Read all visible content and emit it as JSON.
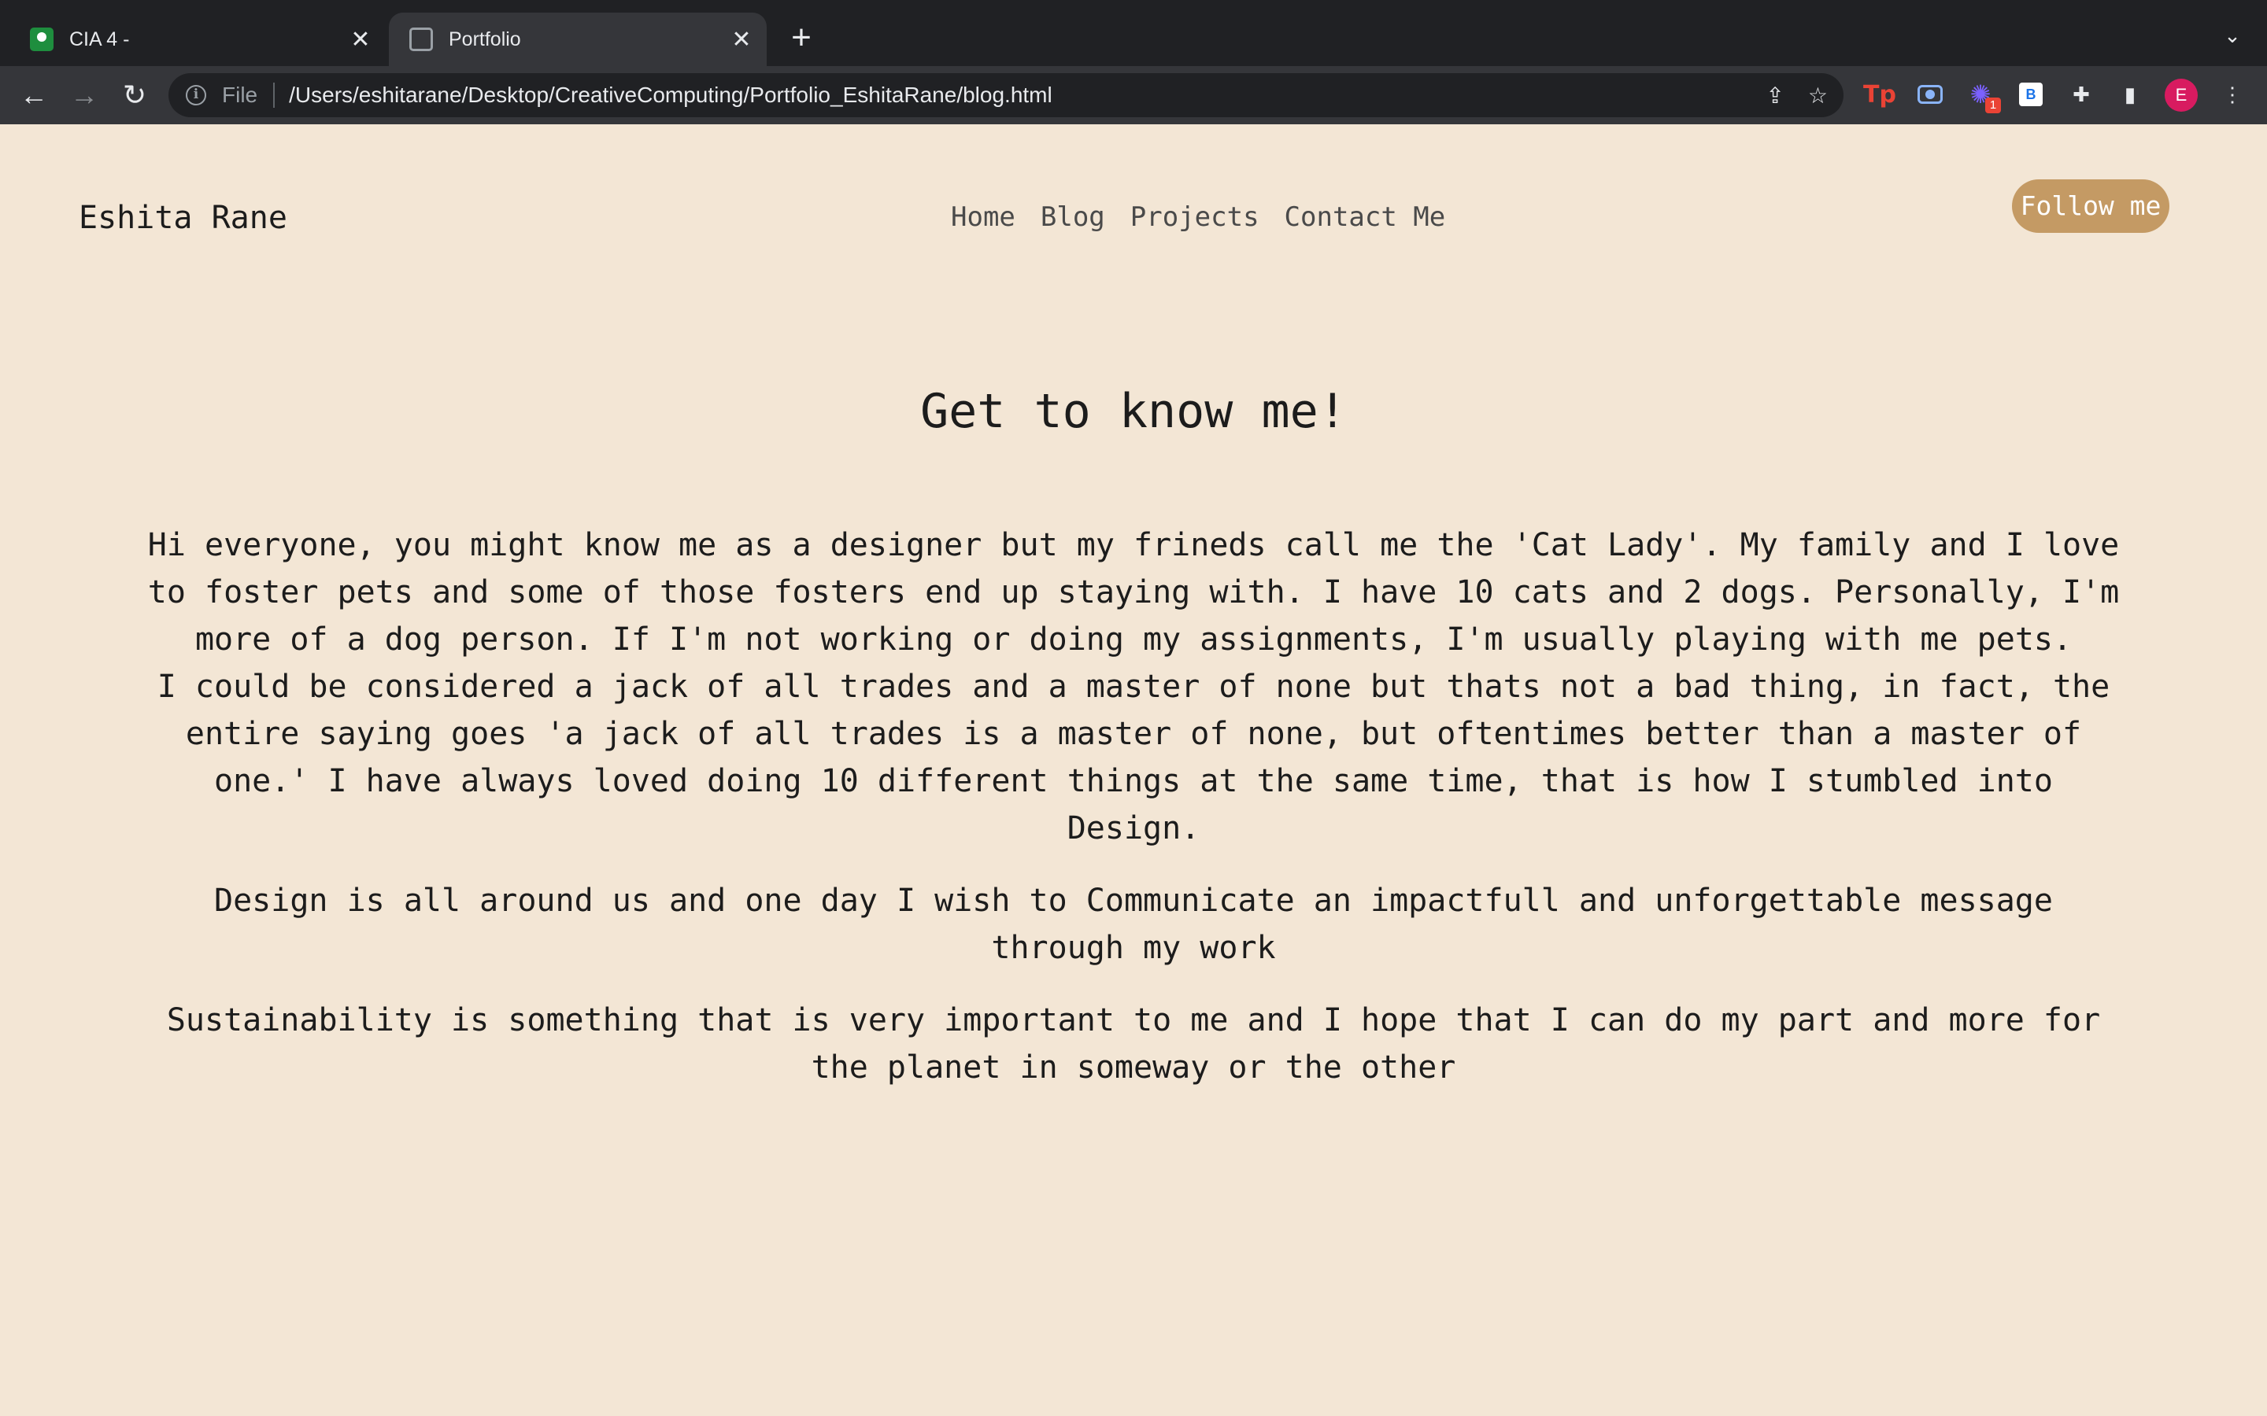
{
  "browser": {
    "tabs": [
      {
        "title": "CIA 4 -",
        "favicon": "classroom-icon",
        "active": false
      },
      {
        "title": "Portfolio",
        "favicon": "globe-icon",
        "active": true
      }
    ],
    "address": {
      "scheme_label": "File",
      "url": "/Users/eshitarane/Desktop/CreativeComputing/Portfolio_EshitaRane/blog.html"
    },
    "profile_initial": "E",
    "extension_badge": "1",
    "extension_b_label": "B",
    "extension_tp_label": "Tp"
  },
  "site": {
    "brand": "Eshita Rane",
    "nav": [
      "Home",
      "Blog",
      "Projects",
      "Contact Me"
    ],
    "follow_label": "Follow me"
  },
  "article": {
    "heading": "Get to know me!",
    "paragraphs": [
      "Hi everyone, you might know me as a designer but my frineds call me the 'Cat Lady'. My family and I love to foster pets and some of those fosters end up staying with. I have 10 cats and 2 dogs. Personally, I'm more of a dog person. If I'm not working or doing my assignments, I'm usually playing with me pets.",
      "I could be considered a jack of all trades and a master of none but thats not a bad thing, in fact, the entire saying goes 'a jack of all trades is a master of none, but oftentimes better than a master of one.' I have always loved doing 10 different things at the same time, that is how I stumbled into Design.",
      "Design is all around us and one day I wish to Communicate an impactfull and unforgettable message through my work",
      "Sustainability is something that is very important to me and I hope that I can do my part and more for the planet in someway or the other"
    ]
  },
  "colors": {
    "page_bg": "#f3e6d5",
    "accent": "#c49a64",
    "chrome_dark": "#202124",
    "chrome_toolbar": "#35363a"
  }
}
